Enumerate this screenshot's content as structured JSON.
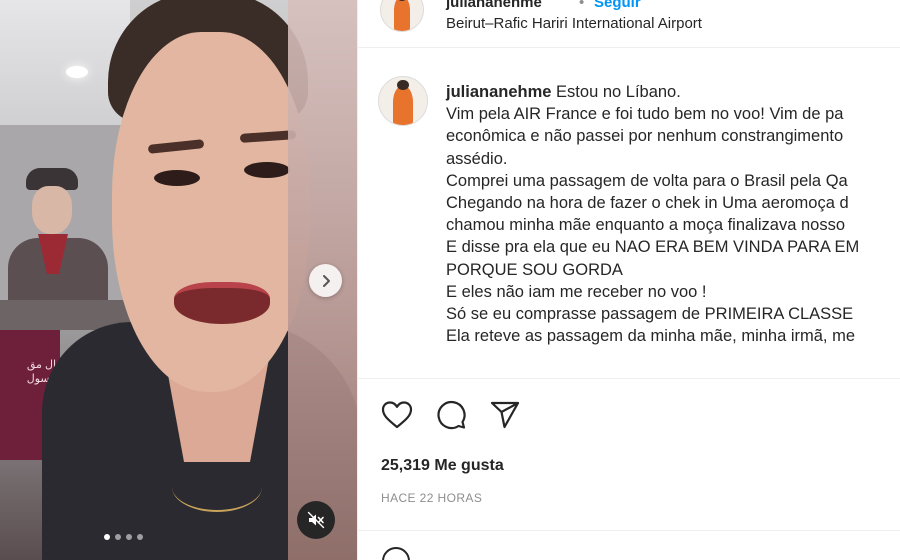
{
  "post": {
    "username": "juliananehme",
    "separator": "•",
    "follow_label": "Seguir",
    "location": "Beirut–Rafic Hariri International Airport"
  },
  "media": {
    "sign_text": "ال مق\nهسول",
    "carousel_dots": 4,
    "active_dot": 0,
    "icons": {
      "next": "chevron-right-icon",
      "mute": "speaker-muted-icon"
    }
  },
  "caption": {
    "username": "juliananehme",
    "lines": [
      "Estou no Líbano.",
      "Vim pela AIR France e foi tudo bem no voo! Vim de pa",
      "econômica e não passei por nenhum constrangimento",
      "assédio.",
      "Comprei uma passagem de volta para o Brasil pela Qa",
      "Chegando na hora de fazer o chek in Uma aeromoça d",
      "chamou minha mãe enquanto a moça finalizava nosso",
      "E disse pra ela que eu NAO ERA BEM VINDA PARA EM",
      "PORQUE SOU GORDA",
      "E eles não iam me receber no voo !",
      "Só se eu comprasse passagem de PRIMEIRA CLASSE",
      "Ela reteve as passagem da minha mãe, minha irmã, me"
    ]
  },
  "actions": {
    "icons": [
      "heart-icon",
      "comment-icon",
      "share-icon"
    ],
    "likes_text": "25,319 Me gusta",
    "time_text": "HACE 22 HORAS"
  },
  "colors": {
    "link": "#0095f6",
    "text": "#262626",
    "muted": "#8e8e8e"
  }
}
